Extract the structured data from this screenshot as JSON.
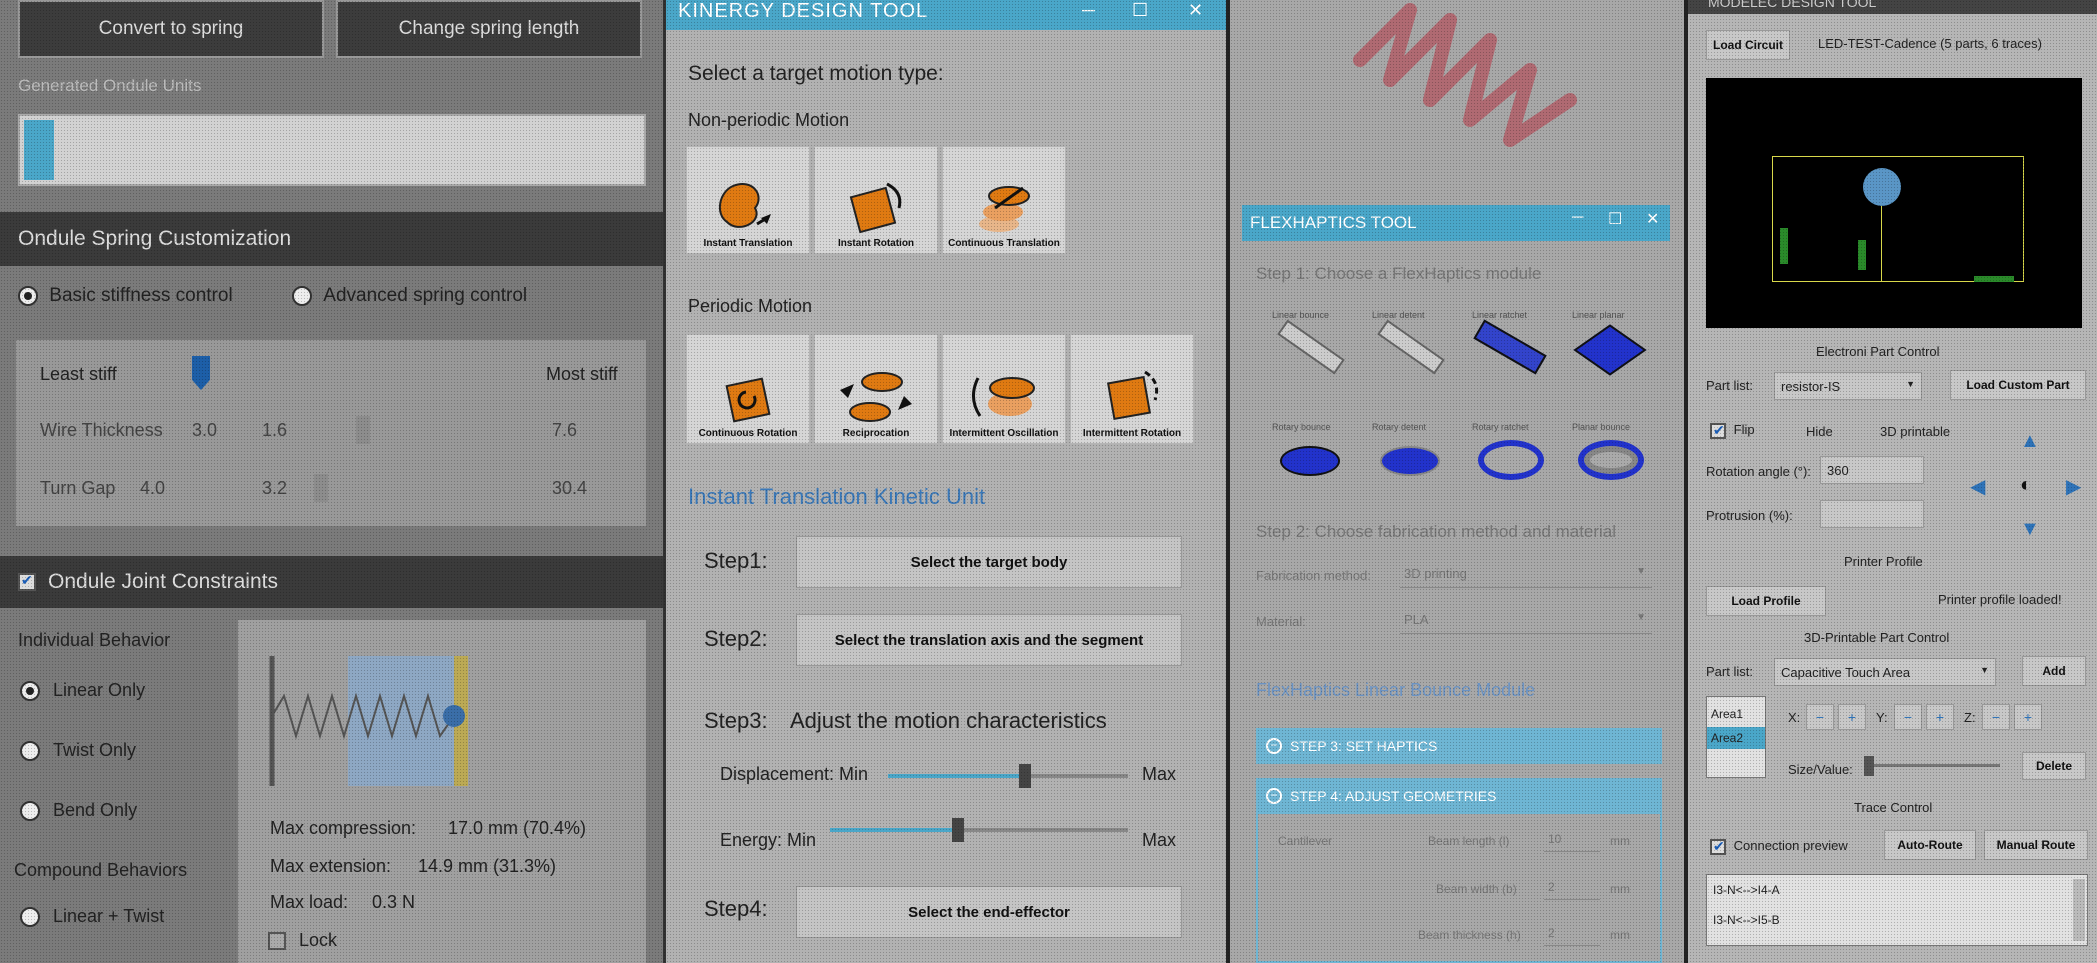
{
  "ondule": {
    "convert_btn": "Convert to spring",
    "change_btn": "Change spring length",
    "generated_label": "Generated Ondule Units",
    "customization_title": "Ondule Spring Customization",
    "basic_label": "Basic stiffness control",
    "advanced_label": "Advanced spring control",
    "least_stiff": "Least stiff",
    "most_stiff": "Most stiff",
    "wire_label": "Wire Thickness",
    "wire_value": "3.0",
    "wire_min": "1.6",
    "wire_max": "7.6",
    "turn_label": "Turn Gap",
    "turn_value": "4.0",
    "turn_min": "3.2",
    "turn_max": "30.4",
    "joint_title": "Ondule Joint Constraints",
    "individual_label": "Individual Behavior",
    "linear_only": "Linear Only",
    "twist_only": "Twist Only",
    "bend_only": "Bend Only",
    "compound_label": "Compound Behaviors",
    "linear_twist": "Linear + Twist",
    "max_compression_label": "Max compression:",
    "max_compression_value": "17.0 mm (70.4%)",
    "max_extension_label": "Max extension:",
    "max_extension_value": "14.9 mm (31.3%)",
    "max_load_label": "Max load:",
    "max_load_value": "0.3 N",
    "lock_label": "Lock"
  },
  "kinergy": {
    "title": "KINERGY DESIGN TOOL",
    "select_prompt": "Select a target motion type:",
    "nonperiodic_label": "Non-periodic Motion",
    "nonperiodic": [
      "Instant Translation",
      "Instant Rotation",
      "Continuous Translation"
    ],
    "periodic_label": "Periodic Motion",
    "periodic": [
      "Continuous Rotation",
      "Reciprocation",
      "Intermittent Oscillation",
      "Intermittent Rotation"
    ],
    "section_title": "Instant Translation Kinetic Unit",
    "step1": "Step1:",
    "step1_btn": "Select the target body",
    "step2": "Step2:",
    "step2_btn": "Select the translation axis and the segment",
    "step3": "Step3:",
    "step3_text": "Adjust the motion characteristics",
    "displacement_label": "Displacement: Min",
    "energy_label": "Energy: Min",
    "max_label": "Max",
    "displacement_pct": 0.57,
    "energy_pct": 0.43,
    "step4": "Step4:",
    "step4_btn": "Select the end-effector"
  },
  "flexhaptics": {
    "title": "FLEXHAPTICS TOOL",
    "step1": "Step 1: Choose a FlexHaptics module",
    "modules": [
      "Linear bounce",
      "Linear detent",
      "Linear ratchet",
      "Linear planar"
    ],
    "modules2": [
      "Rotary bounce",
      "Rotary detent",
      "Rotary ratchet",
      "Planar bounce"
    ],
    "step2": "Step 2: Choose fabrication method and material",
    "fab_label": "Fabrication method:",
    "fab_value": "3D printing",
    "material_label": "Material:",
    "material_value": "PLA",
    "module_title": "FlexHaptics Linear Bounce Module",
    "step3_header": "STEP 3: SET HAPTICS",
    "step4_header": "STEP 4: ADJUST GEOMETRIES",
    "cantilever": "Cantilever",
    "beam_length": "Beam length (l)",
    "beam_length_value": "10",
    "beam_width": "Beam width (b)",
    "beam_width_value": "2",
    "beam_thickness": "Beam thickness (h)",
    "beam_thickness_value": "2",
    "unit": "mm"
  },
  "modelec": {
    "title": "MODELEC DESIGN TOOL",
    "load_circuit": "Load Circuit",
    "circuit_name": "LED-TEST-Cadence (5 parts, 6 traces)",
    "electronic_section": "Electroni Part Control",
    "part_list_label": "Part list:",
    "part_value": "resistor-IS",
    "load_custom": "Load Custom Part",
    "flip": "Flip",
    "hide": "Hide",
    "printable_3d": "3D printable",
    "rotation_label": "Rotation angle (°):",
    "rotation_value": "360",
    "protrusion_label": "Protrusion (%):",
    "printer_section": "Printer Profile",
    "load_profile": "Load Profile",
    "profile_loaded": "Printer profile loaded!",
    "printable_section": "3D-Printable Part Control",
    "part_list2_label": "Part list:",
    "part2_value": "Capacitive Touch Area",
    "add": "Add",
    "areas": [
      "Area1",
      "Area2"
    ],
    "x": "X:",
    "y": "Y:",
    "z": "Z:",
    "minus": "−",
    "plus": "+",
    "size_label": "Size/Value:",
    "delete": "Delete",
    "trace_section": "Trace Control",
    "connection_preview": "Connection preview",
    "auto_route": "Auto-Route",
    "manual_route": "Manual Route",
    "traces": [
      "I3-N<-->I4-A",
      "I3-N<-->I5-B"
    ]
  },
  "colors": {
    "accent": "#4aa7c9",
    "orange": "#e07a12",
    "blue_part": "#2233cc"
  }
}
